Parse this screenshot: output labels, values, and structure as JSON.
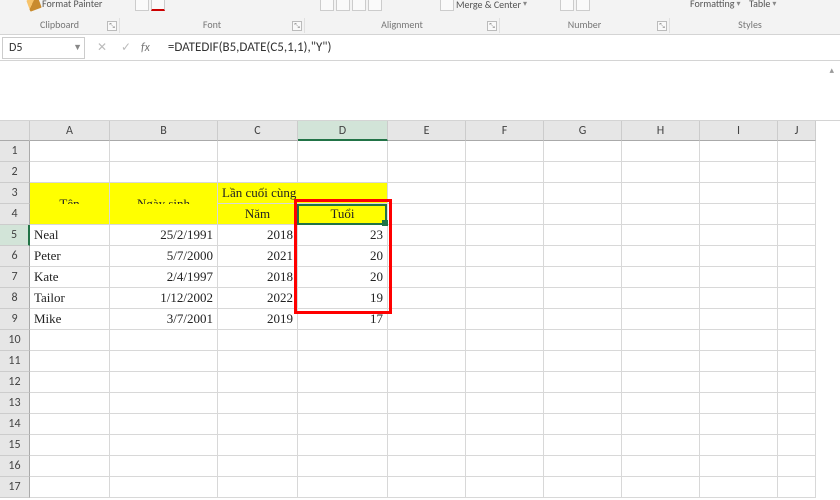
{
  "ribbon": {
    "format_painter": "Format Painter",
    "groups": {
      "clipboard": "Clipboard",
      "font": "Font",
      "alignment": "Alignment",
      "number": "Number",
      "styles": "Styles"
    },
    "merge_center": "Merge & Center",
    "formatting": "Formatting",
    "table": "Table"
  },
  "namebox": {
    "value": "D5"
  },
  "formula": {
    "value": "=DATEDIF(B5,DATE(C5,1,1),\"Y\")"
  },
  "columns": [
    "A",
    "B",
    "C",
    "D",
    "E",
    "F",
    "G",
    "H",
    "I",
    "J"
  ],
  "col_widths": [
    "wA",
    "wB",
    "wC",
    "wD",
    "wE",
    "wF",
    "wG",
    "wH",
    "wI",
    "wJ"
  ],
  "rows": [
    1,
    2,
    3,
    4,
    5,
    6,
    7,
    8,
    9,
    10,
    11,
    12,
    13,
    14,
    15,
    16,
    17
  ],
  "header": {
    "ten": "Tên",
    "ngay_sinh": "Ngày sinh",
    "lan_cuoi": "Lần cuối cùng khám bệnh",
    "nam": "Năm",
    "tuoi": "Tuổi"
  },
  "data_rows": [
    {
      "ten": "Neal",
      "ngay": "25/2/1991",
      "nam": "2018",
      "tuoi": "23"
    },
    {
      "ten": "Peter",
      "ngay": "5/7/2000",
      "nam": "2021",
      "tuoi": "20"
    },
    {
      "ten": "Kate",
      "ngay": "2/4/1997",
      "nam": "2018",
      "tuoi": "20"
    },
    {
      "ten": "Tailor",
      "ngay": "1/12/2002",
      "nam": "2022",
      "tuoi": "19"
    },
    {
      "ten": "Mike",
      "ngay": "3/7/2001",
      "nam": "2019",
      "tuoi": "17"
    }
  ],
  "selected_column": "D",
  "selected_row": 5
}
